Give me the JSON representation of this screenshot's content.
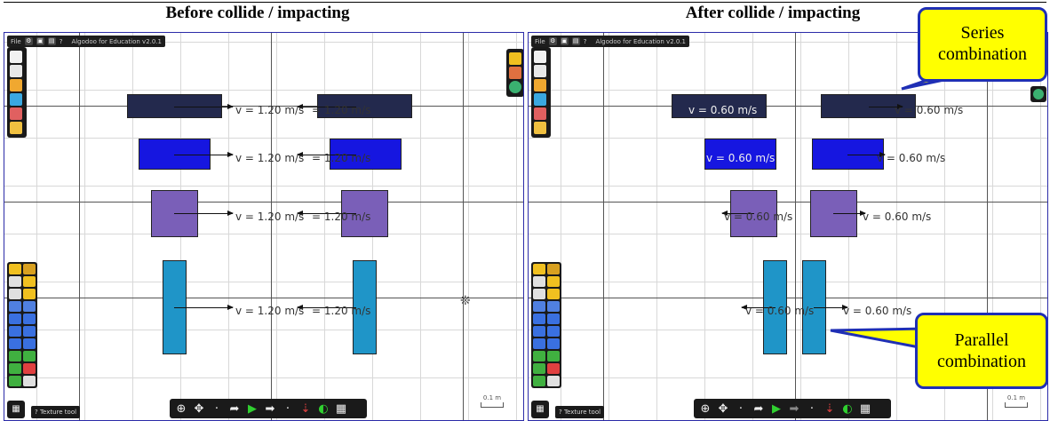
{
  "headers": {
    "left": "Before collide / impacting",
    "right": "After collide / impacting"
  },
  "app": {
    "menu_file": "File",
    "title": "Algodoo for Education v2.0.1",
    "help_glyph": "?",
    "texture_tool": "Texture tool",
    "scale_label": "0.1 m"
  },
  "before": {
    "velocities": [
      "v = 1.20 m/s",
      "v = 1.20 m/s",
      "v = 1.20 m/s",
      "v = 1.20 m/s"
    ],
    "velocities_left": [
      "= 1.20 m/s",
      "= 1.20 m/s",
      "= 1.20 m/s",
      "= 1.20 m/s"
    ]
  },
  "after": {
    "left_velocities": [
      "v = 0.60 m/s",
      "v = 0.60 m/s",
      "v = 0.60 m/s",
      "v = 0.60 m/s"
    ],
    "right_velocities": [
      "v = 0.60 m/s",
      "v = 0.60 m/s",
      "v = 0.60 m/s",
      "v = 0.60 m/s"
    ]
  },
  "callouts": {
    "series": "Series combination",
    "parallel": "Parallel combination"
  },
  "colors": {
    "row1": "#23294d",
    "row2": "#1616e0",
    "row3": "#7a5fb8",
    "row4": "#1f95c8",
    "callout_fill": "#ffff00",
    "callout_border": "#1f2fb5"
  },
  "icons": {
    "new_scene": "new-scene-icon",
    "save": "save-icon",
    "open": "folder-icon",
    "play": "play-icon",
    "zoom": "zoom-icon",
    "move": "move-icon",
    "undo": "undo-icon",
    "redo": "redo-icon",
    "grid": "grid-icon"
  }
}
